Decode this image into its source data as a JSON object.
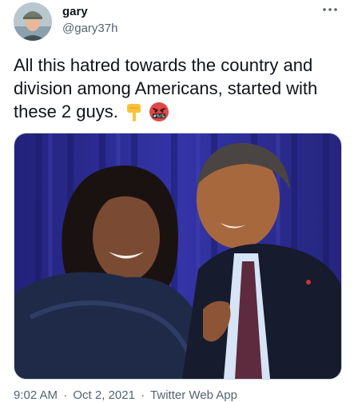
{
  "author": {
    "display_name": "gary",
    "handle": "@gary37h"
  },
  "tweet": {
    "text": "All this hatred towards the country and division among Americans, started with these 2 guys.",
    "emojis": [
      "backhand-index-pointing-down",
      "face-with-symbols-on-mouth"
    ],
    "emoji_symbols": "#%!&"
  },
  "meta": {
    "time": "9:02 AM",
    "date": "Oct 2, 2021",
    "source": "Twitter Web App",
    "separator": "·"
  },
  "icons": {
    "more": "more-horizontal-icon"
  },
  "colors": {
    "text_primary": "#0f1419",
    "text_secondary": "#536471",
    "curtain_blue": "#2a2a8c"
  }
}
